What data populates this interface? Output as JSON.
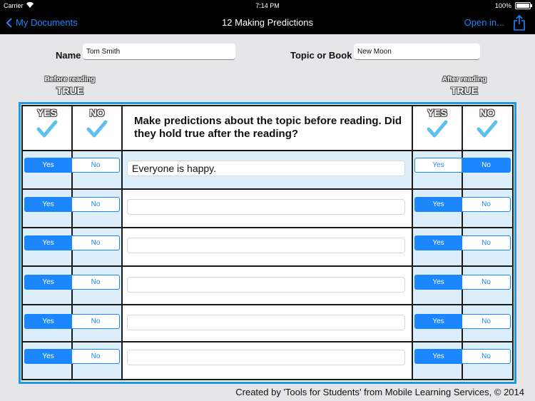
{
  "status_bar": {
    "carrier": "Carrier",
    "time": "7:14 PM",
    "battery": "100%"
  },
  "nav": {
    "back_label": "My Documents",
    "title": "12 Making Predictions",
    "open_in_label": "Open in..."
  },
  "form": {
    "name_label": "Name",
    "name_value": "Tom Smith",
    "topic_label": "Topic or Book",
    "topic_value": "New Moon"
  },
  "before_reading": {
    "caption": "Before reading",
    "value": "TRUE"
  },
  "after_reading": {
    "caption": "After reading",
    "value": "TRUE"
  },
  "table": {
    "yes_header": "YES",
    "no_header": "NO",
    "prompt": "Make predictions about the topic before reading. Did they hold true after the reading?",
    "yes_label": "Yes",
    "no_label": "No",
    "rows": [
      {
        "before": "yes",
        "prediction": "Everyone is happy.",
        "after": "no"
      },
      {
        "before": "yes",
        "prediction": "",
        "after": "yes"
      },
      {
        "before": "yes",
        "prediction": "",
        "after": "yes"
      },
      {
        "before": "yes",
        "prediction": "",
        "after": "yes"
      },
      {
        "before": "yes",
        "prediction": "",
        "after": "yes"
      },
      {
        "before": "yes",
        "prediction": "",
        "after": "yes"
      }
    ]
  },
  "credit": "Created by 'Tools for Students' from Mobile Learning Services, © 2014",
  "colors": {
    "accent": "#1c86ff",
    "frame": "#1a9ae8",
    "row_tint": "#ddeefb",
    "check": "#5fc0f0"
  }
}
